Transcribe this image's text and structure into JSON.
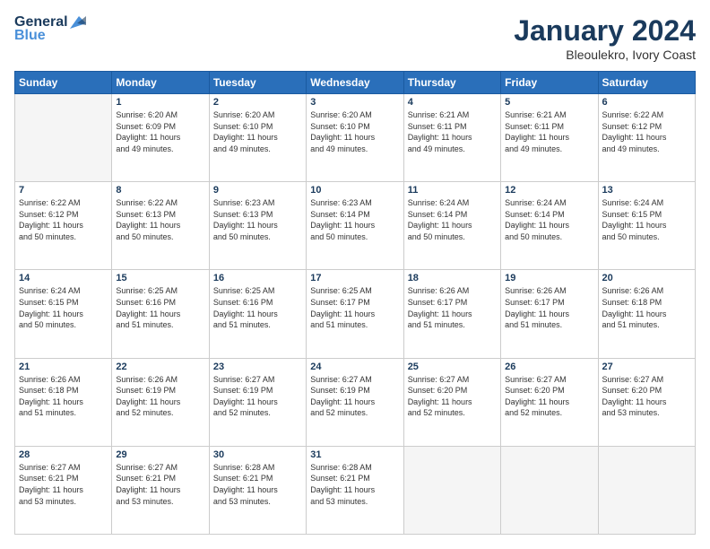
{
  "logo": {
    "line1": "General",
    "line2": "Blue"
  },
  "title": "January 2024",
  "location": "Bleoulekro, Ivory Coast",
  "weekdays": [
    "Sunday",
    "Monday",
    "Tuesday",
    "Wednesday",
    "Thursday",
    "Friday",
    "Saturday"
  ],
  "weeks": [
    [
      {
        "day": "",
        "info": ""
      },
      {
        "day": "1",
        "info": "Sunrise: 6:20 AM\nSunset: 6:09 PM\nDaylight: 11 hours\nand 49 minutes."
      },
      {
        "day": "2",
        "info": "Sunrise: 6:20 AM\nSunset: 6:10 PM\nDaylight: 11 hours\nand 49 minutes."
      },
      {
        "day": "3",
        "info": "Sunrise: 6:20 AM\nSunset: 6:10 PM\nDaylight: 11 hours\nand 49 minutes."
      },
      {
        "day": "4",
        "info": "Sunrise: 6:21 AM\nSunset: 6:11 PM\nDaylight: 11 hours\nand 49 minutes."
      },
      {
        "day": "5",
        "info": "Sunrise: 6:21 AM\nSunset: 6:11 PM\nDaylight: 11 hours\nand 49 minutes."
      },
      {
        "day": "6",
        "info": "Sunrise: 6:22 AM\nSunset: 6:12 PM\nDaylight: 11 hours\nand 49 minutes."
      }
    ],
    [
      {
        "day": "7",
        "info": "Sunrise: 6:22 AM\nSunset: 6:12 PM\nDaylight: 11 hours\nand 50 minutes."
      },
      {
        "day": "8",
        "info": "Sunrise: 6:22 AM\nSunset: 6:13 PM\nDaylight: 11 hours\nand 50 minutes."
      },
      {
        "day": "9",
        "info": "Sunrise: 6:23 AM\nSunset: 6:13 PM\nDaylight: 11 hours\nand 50 minutes."
      },
      {
        "day": "10",
        "info": "Sunrise: 6:23 AM\nSunset: 6:14 PM\nDaylight: 11 hours\nand 50 minutes."
      },
      {
        "day": "11",
        "info": "Sunrise: 6:24 AM\nSunset: 6:14 PM\nDaylight: 11 hours\nand 50 minutes."
      },
      {
        "day": "12",
        "info": "Sunrise: 6:24 AM\nSunset: 6:14 PM\nDaylight: 11 hours\nand 50 minutes."
      },
      {
        "day": "13",
        "info": "Sunrise: 6:24 AM\nSunset: 6:15 PM\nDaylight: 11 hours\nand 50 minutes."
      }
    ],
    [
      {
        "day": "14",
        "info": "Sunrise: 6:24 AM\nSunset: 6:15 PM\nDaylight: 11 hours\nand 50 minutes."
      },
      {
        "day": "15",
        "info": "Sunrise: 6:25 AM\nSunset: 6:16 PM\nDaylight: 11 hours\nand 51 minutes."
      },
      {
        "day": "16",
        "info": "Sunrise: 6:25 AM\nSunset: 6:16 PM\nDaylight: 11 hours\nand 51 minutes."
      },
      {
        "day": "17",
        "info": "Sunrise: 6:25 AM\nSunset: 6:17 PM\nDaylight: 11 hours\nand 51 minutes."
      },
      {
        "day": "18",
        "info": "Sunrise: 6:26 AM\nSunset: 6:17 PM\nDaylight: 11 hours\nand 51 minutes."
      },
      {
        "day": "19",
        "info": "Sunrise: 6:26 AM\nSunset: 6:17 PM\nDaylight: 11 hours\nand 51 minutes."
      },
      {
        "day": "20",
        "info": "Sunrise: 6:26 AM\nSunset: 6:18 PM\nDaylight: 11 hours\nand 51 minutes."
      }
    ],
    [
      {
        "day": "21",
        "info": "Sunrise: 6:26 AM\nSunset: 6:18 PM\nDaylight: 11 hours\nand 51 minutes."
      },
      {
        "day": "22",
        "info": "Sunrise: 6:26 AM\nSunset: 6:19 PM\nDaylight: 11 hours\nand 52 minutes."
      },
      {
        "day": "23",
        "info": "Sunrise: 6:27 AM\nSunset: 6:19 PM\nDaylight: 11 hours\nand 52 minutes."
      },
      {
        "day": "24",
        "info": "Sunrise: 6:27 AM\nSunset: 6:19 PM\nDaylight: 11 hours\nand 52 minutes."
      },
      {
        "day": "25",
        "info": "Sunrise: 6:27 AM\nSunset: 6:20 PM\nDaylight: 11 hours\nand 52 minutes."
      },
      {
        "day": "26",
        "info": "Sunrise: 6:27 AM\nSunset: 6:20 PM\nDaylight: 11 hours\nand 52 minutes."
      },
      {
        "day": "27",
        "info": "Sunrise: 6:27 AM\nSunset: 6:20 PM\nDaylight: 11 hours\nand 53 minutes."
      }
    ],
    [
      {
        "day": "28",
        "info": "Sunrise: 6:27 AM\nSunset: 6:21 PM\nDaylight: 11 hours\nand 53 minutes."
      },
      {
        "day": "29",
        "info": "Sunrise: 6:27 AM\nSunset: 6:21 PM\nDaylight: 11 hours\nand 53 minutes."
      },
      {
        "day": "30",
        "info": "Sunrise: 6:28 AM\nSunset: 6:21 PM\nDaylight: 11 hours\nand 53 minutes."
      },
      {
        "day": "31",
        "info": "Sunrise: 6:28 AM\nSunset: 6:21 PM\nDaylight: 11 hours\nand 53 minutes."
      },
      {
        "day": "",
        "info": ""
      },
      {
        "day": "",
        "info": ""
      },
      {
        "day": "",
        "info": ""
      }
    ]
  ]
}
